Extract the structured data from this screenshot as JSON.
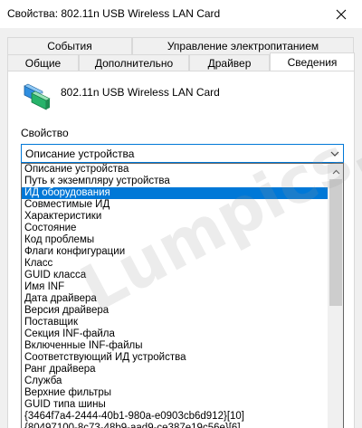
{
  "window": {
    "title": "Свойства: 802.11n USB Wireless LAN Card"
  },
  "tabs_top": [
    {
      "label": "События"
    },
    {
      "label": "Управление электропитанием"
    }
  ],
  "tabs_bottom": [
    {
      "label": "Общие"
    },
    {
      "label": "Дополнительно"
    },
    {
      "label": "Драйвер"
    },
    {
      "label": "Сведения"
    }
  ],
  "active_tab": "Сведения",
  "device": {
    "name": "802.11n USB Wireless LAN Card",
    "icon": "network-adapter-icon"
  },
  "property": {
    "label": "Свойство",
    "selected_value": "Описание устройства",
    "options": [
      "Описание устройства",
      "Путь к экземпляру устройства",
      "ИД оборудования",
      "Совместимые ИД",
      "Характеристики",
      "Состояние",
      "Код проблемы",
      "Флаги конфигурации",
      "Класс",
      "GUID класса",
      "Имя INF",
      "Дата драйвера",
      "Версия драйвера",
      "Поставщик",
      "Секция INF-файла",
      "Включенные INF-файлы",
      "Соответствующий ИД устройства",
      "Ранг драйвера",
      "Служба",
      "Верхние фильтры",
      "GUID типа шины",
      "{3464f7a4-2444-40b1-980a-e0903cb6d912}[10]",
      "{80497100-8c73-48b9-aad9-ce387e19c56e}[6]"
    ],
    "highlighted_option": "ИД оборудования"
  },
  "colors": {
    "selection": "#0078d7",
    "window_bg": "#f0f0f0",
    "panel_bg": "#ffffff"
  }
}
